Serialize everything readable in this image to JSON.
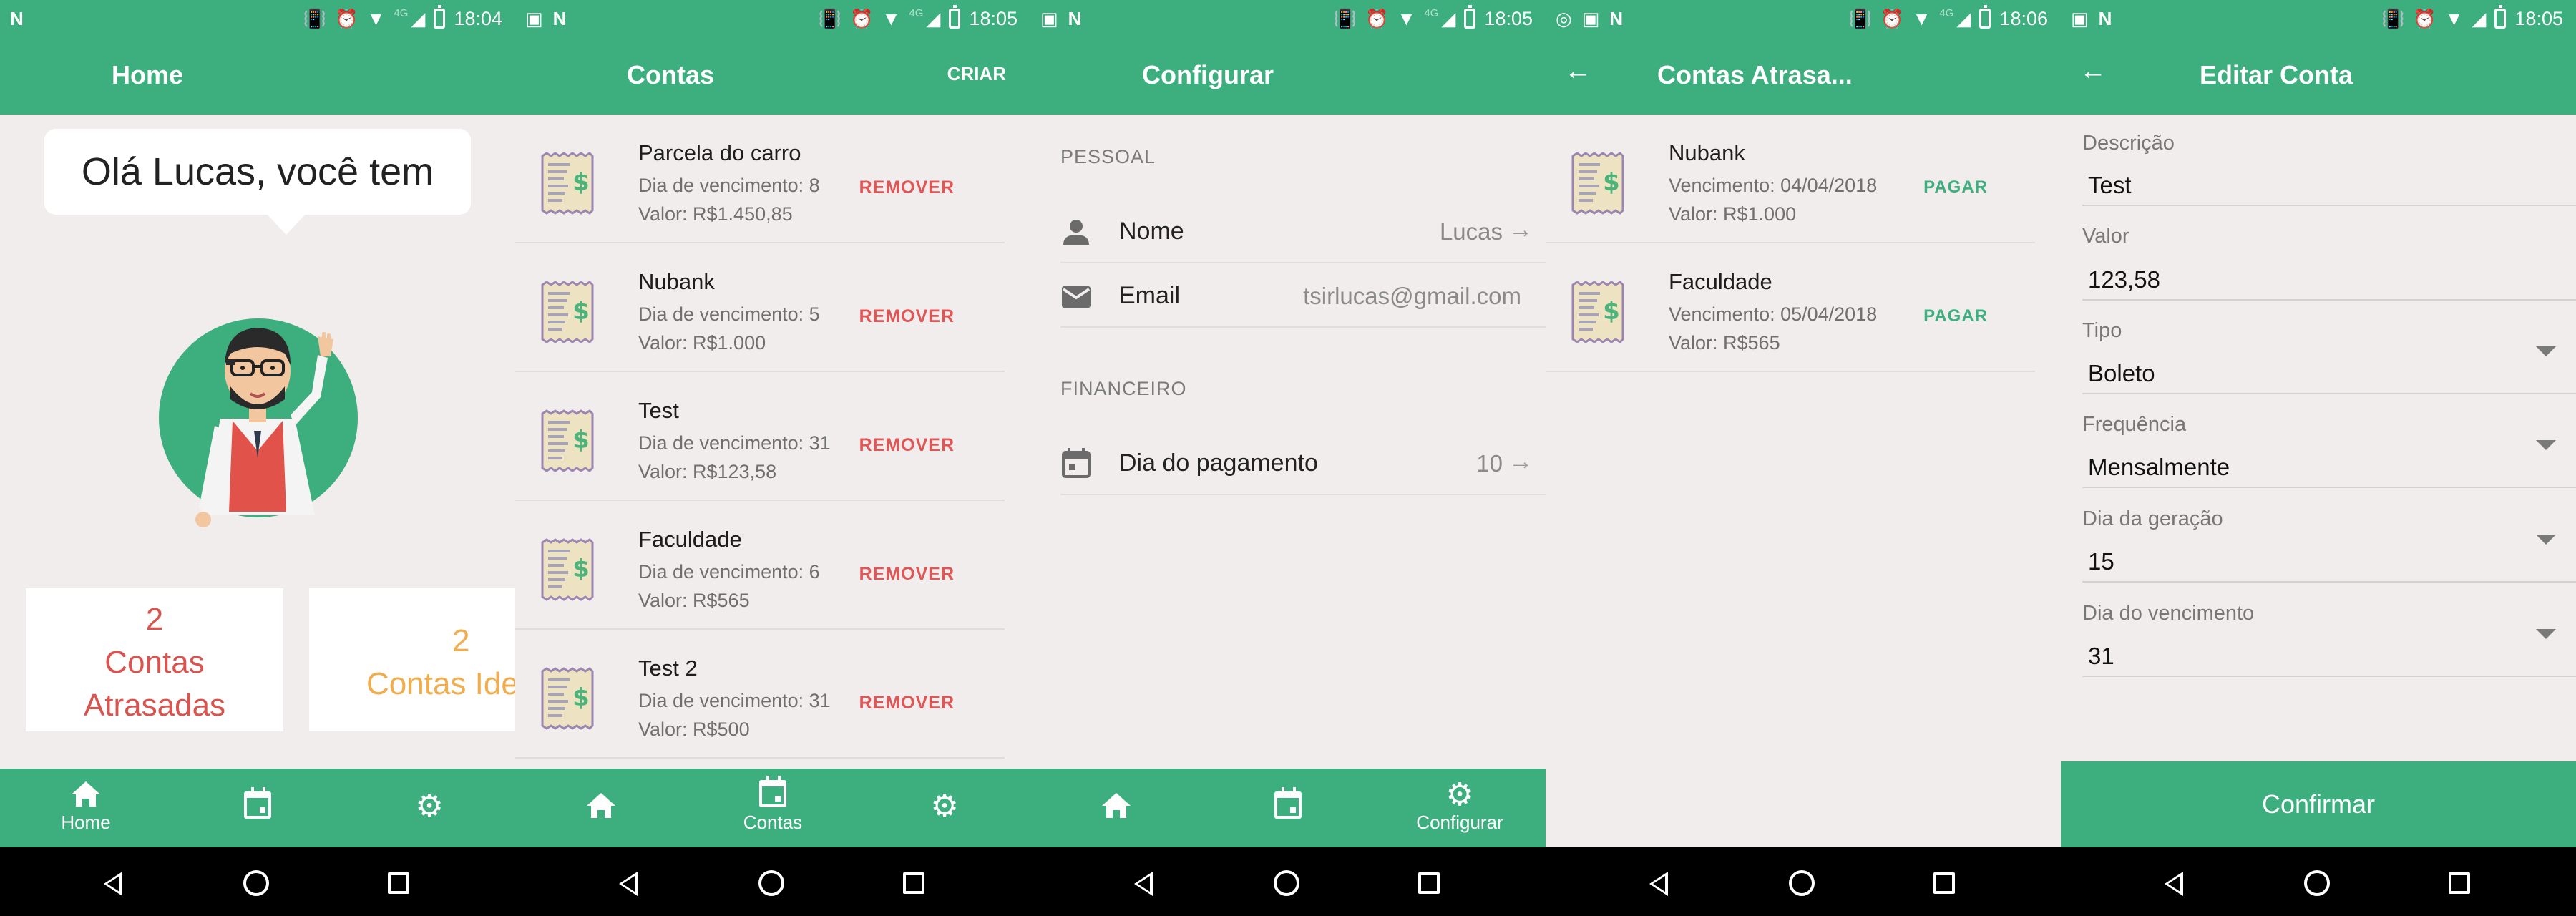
{
  "colors": {
    "primary": "#3daf7f",
    "danger": "#e05555",
    "warning": "#f0ad4e",
    "background": "#f2eded"
  },
  "screens": [
    {
      "status": {
        "time": "18:04",
        "network": "4G"
      },
      "title": "Home",
      "bubble_text": "Olá Lucas, você tem",
      "cards": [
        {
          "count": "2",
          "label1": "Contas",
          "label2": "Atrasadas"
        },
        {
          "count": "2",
          "label1": "Contas Idea"
        }
      ],
      "nav": [
        {
          "icon": "home-icon",
          "label": "Home"
        },
        {
          "icon": "calendar-icon",
          "label": ""
        },
        {
          "icon": "gear-icon",
          "label": ""
        }
      ]
    },
    {
      "status": {
        "time": "18:05",
        "network": "4G"
      },
      "title": "Contas",
      "action": "CRIAR",
      "items": [
        {
          "name": "Parcela do carro",
          "due": "Dia de vencimento: 8",
          "value": "Valor: R$1.450,85",
          "action": "REMOVER"
        },
        {
          "name": "Nubank",
          "due": "Dia de vencimento: 5",
          "value": "Valor: R$1.000",
          "action": "REMOVER"
        },
        {
          "name": "Test",
          "due": "Dia de vencimento: 31",
          "value": "Valor: R$123,58",
          "action": "REMOVER"
        },
        {
          "name": "Faculdade",
          "due": "Dia de vencimento: 6",
          "value": "Valor: R$565",
          "action": "REMOVER"
        },
        {
          "name": "Test 2",
          "due": "Dia de vencimento: 31",
          "value": "Valor: R$500",
          "action": "REMOVER"
        }
      ],
      "nav": [
        {
          "icon": "home-icon",
          "label": ""
        },
        {
          "icon": "calendar-icon",
          "label": "Contas"
        },
        {
          "icon": "gear-icon",
          "label": ""
        }
      ]
    },
    {
      "status": {
        "time": "18:05",
        "network": "4G"
      },
      "title": "Configurar",
      "sections": [
        {
          "header": "PESSOAL"
        },
        {
          "header": "FINANCEIRO"
        }
      ],
      "rows": [
        {
          "icon": "person-icon",
          "label": "Nome",
          "value": "Lucas"
        },
        {
          "icon": "email-icon",
          "label": "Email",
          "value": "tsirlucas@gmail.com"
        },
        {
          "icon": "calendar-icon",
          "label": "Dia do pagamento",
          "value": "10"
        }
      ],
      "nav": [
        {
          "icon": "home-icon",
          "label": ""
        },
        {
          "icon": "calendar-icon",
          "label": ""
        },
        {
          "icon": "gear-icon",
          "label": "Configurar"
        }
      ]
    },
    {
      "status": {
        "time": "18:06",
        "network": "4G"
      },
      "title": "Contas Atrasa...",
      "items": [
        {
          "name": "Nubank",
          "due": "Vencimento: 04/04/2018",
          "value": "Valor: R$1.000",
          "action": "PAGAR"
        },
        {
          "name": "Faculdade",
          "due": "Vencimento: 05/04/2018",
          "value": "Valor: R$565",
          "action": "PAGAR"
        }
      ]
    },
    {
      "status": {
        "time": "18:05"
      },
      "title": "Editar Conta",
      "fields": [
        {
          "label": "Descrição",
          "value": "Test",
          "dropdown": false
        },
        {
          "label": "Valor",
          "value": "123,58",
          "dropdown": false
        },
        {
          "label": "Tipo",
          "value": "Boleto",
          "dropdown": true
        },
        {
          "label": "Frequência",
          "value": "Mensalmente",
          "dropdown": true
        },
        {
          "label": "Dia da geração",
          "value": "15",
          "dropdown": true
        },
        {
          "label": "Dia do vencimento",
          "value": "31",
          "dropdown": true
        }
      ],
      "confirm": "Confirmar"
    }
  ]
}
